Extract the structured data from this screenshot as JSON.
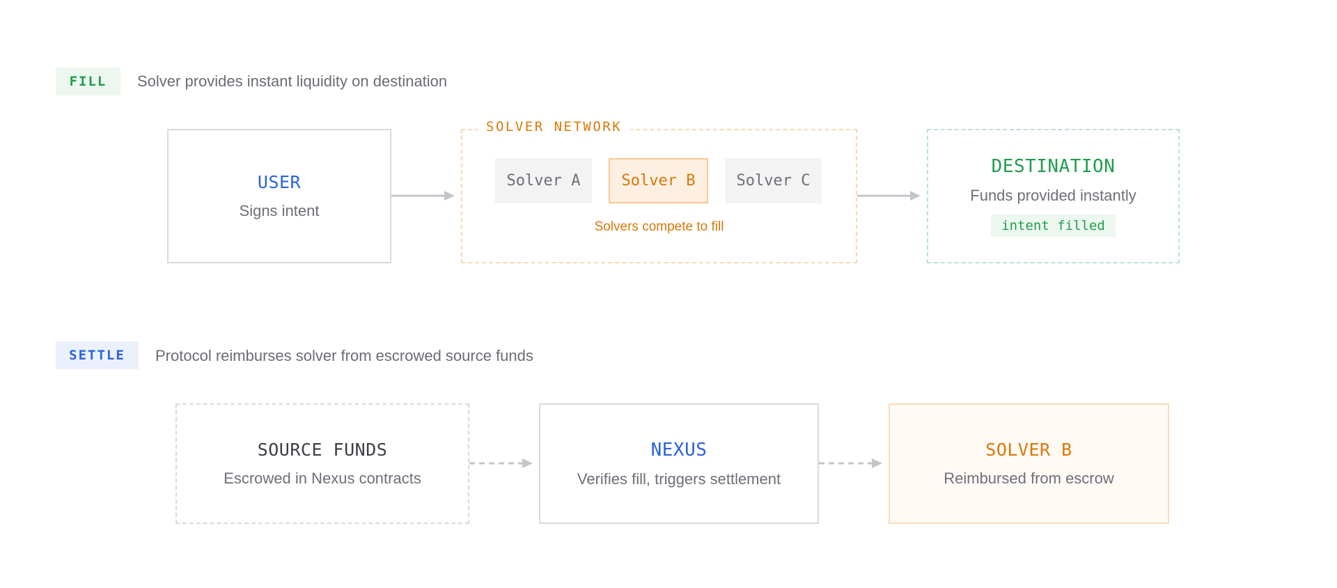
{
  "fill": {
    "tag": "FILL",
    "description": "Solver provides instant liquidity on destination",
    "user": {
      "title": "USER",
      "subtitle": "Signs intent"
    },
    "network": {
      "label": "SOLVER NETWORK",
      "solvers": [
        "Solver A",
        "Solver B",
        "Solver C"
      ],
      "active_solver": "Solver B",
      "caption": "Solvers compete to fill"
    },
    "destination": {
      "title": "DESTINATION",
      "subtitle": "Funds provided instantly",
      "badge": "intent filled"
    }
  },
  "settle": {
    "tag": "SETTLE",
    "description": "Protocol reimburses solver from escrowed source funds",
    "source": {
      "title": "SOURCE FUNDS",
      "subtitle": "Escrowed in Nexus contracts"
    },
    "nexus": {
      "title": "NEXUS",
      "subtitle": "Verifies fill, triggers settlement"
    },
    "solver_b": {
      "title": "SOLVER B",
      "subtitle": "Reimbursed from escrow"
    }
  },
  "colors": {
    "green": "#1f9d4d",
    "blue": "#2a63dc",
    "orange": "#d97806",
    "gray_text": "#6e6e78",
    "arrow": "#c4c4cb"
  }
}
